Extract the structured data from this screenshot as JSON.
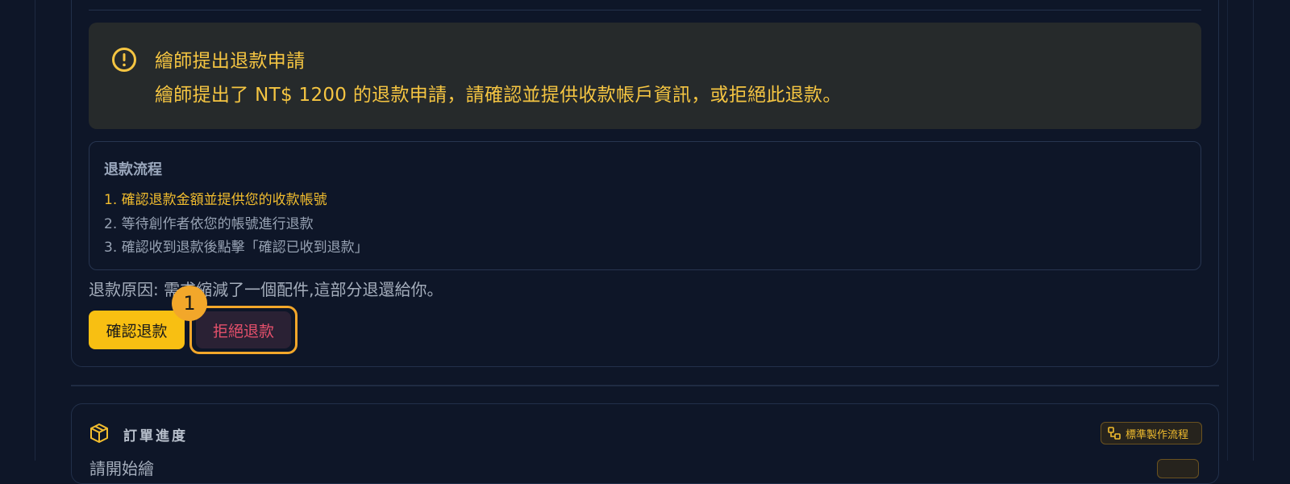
{
  "alert": {
    "icon": "exclamation-circle-icon",
    "title": "繪師提出退款申請",
    "message": "繪師提出了 NT$ 1200 的退款申請，請確認並提供收款帳戶資訊，或拒絕此退款。",
    "color": "#f5c542"
  },
  "refund_flow": {
    "title": "退款流程",
    "steps": [
      "1. 確認退款金額並提供您的收款帳號",
      "2. 等待創作者依您的帳號進行退款",
      "3. 確認收到退款後點擊「確認已收到退款」"
    ]
  },
  "reason": "退款原因: 需求縮減了一個配件,這部分退還給你。",
  "buttons": {
    "confirm": "確認退款",
    "reject": "拒絕退款"
  },
  "marker": "1",
  "order": {
    "icon": "box-icon",
    "title": "訂單進度",
    "flow_badge": "標準製作流程",
    "flow_icon": "flow-icon",
    "partial_label": "請開始繪"
  },
  "colors": {
    "background": "#0e1628",
    "accent": "#f8bf12",
    "reject_text": "#e4506b"
  }
}
